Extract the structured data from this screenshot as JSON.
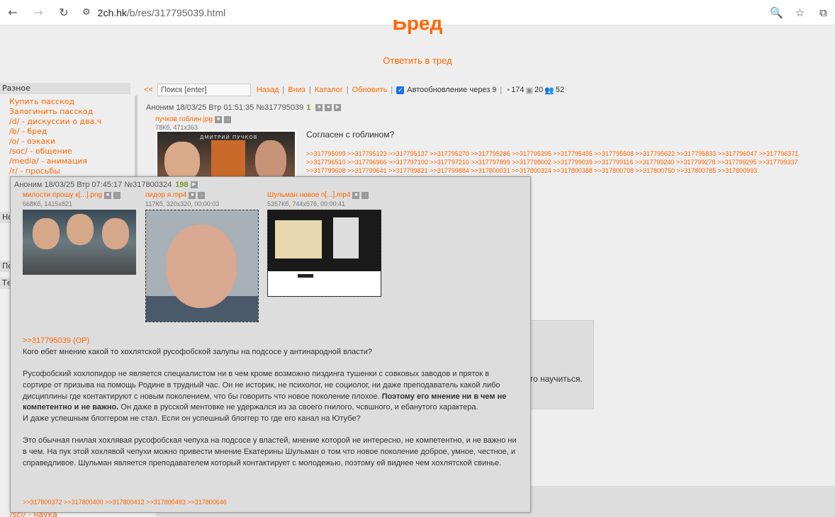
{
  "browser": {
    "back_icon": "←",
    "forward_icon": "→",
    "reload_icon": "↻",
    "site_info_icon": "⚙",
    "url_host": "2ch.hk",
    "url_path": "/b/res/317795039.html",
    "zoom_icon": "🔍",
    "star_icon": "☆",
    "extensions_icon": "⧉"
  },
  "thread": {
    "title": "Бред",
    "reply_link": "Ответить в тред"
  },
  "sidebar": {
    "header": "Разное",
    "items": [
      "Купить пасскод",
      "Залогинить пасскод",
      "/d/ - дискуссии о два.ч",
      "/b/ - бред",
      "/o/ - оэкаки",
      "/soc/ - общение",
      "/media/ - анимация",
      "/r/ - просьбы"
    ],
    "stub1": "Но",
    "stub2": "По",
    "stub3": "Те",
    "bottom_item": "/sci/ - наука"
  },
  "toolbar": {
    "top_link": "<<",
    "search_placeholder": "Поиск [enter]",
    "back": "Назад",
    "down": "Вниз",
    "catalog": "Каталог",
    "refresh": "Обновить",
    "autoupdate": "Автообновление через 9",
    "posts_count": "174",
    "images_count": "20",
    "posters_count": "52",
    "separator": "|"
  },
  "op": {
    "author": "Аноним",
    "datetime": "18/03/25 Втр 01:51:35",
    "number": "№317795039",
    "index": "1",
    "filename": "пучков гоблин.jpg",
    "filemeta": "78Кб, 471x363",
    "image_caption": "ДМИТРИЙ ПУЧКОВ",
    "text": "Согласен с гоблином?",
    "replies": [
      ">>317795099 >>317795123 >>317795137 >>317795270 >>317795286 >>317795295 >>317795455 >>317795508 >>317795622 >>317795833 >>317796047 >>317796371",
      ">>317796510 >>317796966 >>317797100 >>317797210 >>317797899 >>317798002 >>317799039 >>317799116 >>317799240 >>317799278 >>317799295 >>317799337",
      ">>317799608 >>317799641 >>317799821 >>317799884 >>317800031 >>317800324 >>317800388 >>317800708 >>317800750 >>317800785 >>317800993"
    ]
  },
  "background_post": {
    "text_fragment": "го научиться."
  },
  "popup": {
    "author": "Аноним",
    "datetime": "18/03/25 Втр 07:45:17",
    "number": "№317800324",
    "index": "198",
    "files": [
      {
        "name": "милости прошу к[...].png",
        "meta": "668Кб, 1415x821"
      },
      {
        "name": "пидор я.mp4",
        "meta": "117Кб, 320x320, 00:00:03"
      },
      {
        "name": "Шульман новое п[...].mp4",
        "meta": "5357Кб, 744x576, 00:00:41"
      }
    ],
    "op_ref": ">>317795039 (OP)",
    "p1": "Кого ебет мнение какой то хохлятской русофобской залупы на подсосе у антинародной власти?",
    "p2_a": "Русофобский хохлопидор не является специалистом ни в чем кроме возможно пиздинга тушенки с совковых заводов и пряток в сортире от призыва на помощь Родине в трудный час. Он не историк, не психолог, не социолог, ни даже преподаватель какой либо дисциплины где контактируют с новым поколением, что бы говорить что новое поколение плохое.",
    "p2_bold": "Поэтому его мнение ни в чем не компетентно и не важно.",
    "p2_b": "Он даже в русской ментовке не удержался из за своего гнилого, чсвшного, и ебанутого характера.",
    "p3": "И даже успешным блоггером не стал. Если он успешный блоггер то где его канал на Ютубе?",
    "p4": "Это обычная гнилая хохлявая русофобская чепуха на подсосе у властей, мнение которой не интересно, не компетентно, и не важно ни в чем. На пук этой хохлявой чепухи можно привести мнение Екатерины Шульман о том что новое поколение доброе, умное, честное, и справедливое. Шульман является преподавателем который контактирует с молодежью, поэтому ей виднее чем хохлятской свинье.",
    "replies": ">>317800372 >>317800400 >>317800412 >>317800493 >>317800646"
  }
}
